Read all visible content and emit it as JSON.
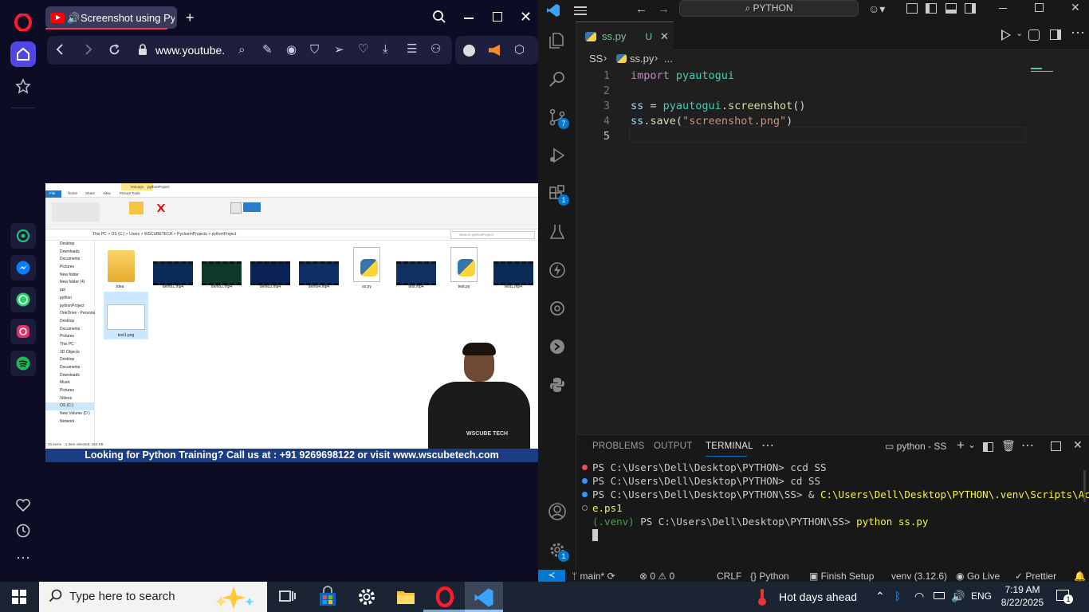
{
  "opera": {
    "tab_title": "Screenshot using Pyth",
    "address": "www.youtube.",
    "video_banner": "Looking for Python Training? Call us at : +91 9269698122 or visit www.wscubetech.com",
    "explorer": {
      "ribbon_tabs": [
        "File",
        "Home",
        "Share",
        "View",
        "Picture Tools"
      ],
      "manage_label": "Manage",
      "window_title": "pythonProject",
      "path": "This PC  >  OS (C:)  >  Users  >  WSCUBETECH  >  PycharmProjects  >  pythonProject",
      "search_placeholder": "Search pythonProject",
      "nav_items": [
        "Desktop",
        "Downloads",
        "Documents",
        "Pictures",
        "New folder",
        "New folder (4)",
        "ppt",
        "python",
        "pythonProject",
        "OneDrive - Persona",
        "Desktop",
        "Documents",
        "Pictures",
        "This PC",
        "3D Objects",
        "Desktop",
        "Documents",
        "Downloads",
        "Music",
        "Pictures",
        "Videos",
        "OS (C:)",
        "New Volume (D:)",
        "Network"
      ],
      "files": [
        ".idea",
        "demo1.mp4",
        "demo2.mp4",
        "demo3.mp4",
        "demo4.mp4",
        "ss.py",
        "test.mp4",
        "test.py",
        "test1.mp4"
      ],
      "selected_file": "test1.png",
      "status": "10 items    1 item selected  164 KB",
      "shirt_text": "WSCUBE TECH"
    }
  },
  "vscode": {
    "search_label": "PYTHON",
    "tab_name": "ss.py",
    "tab_status": "U",
    "breadcrumb": {
      "folder": "SS",
      "file": "ss.py",
      "more": "..."
    },
    "code_lines": [
      {
        "n": "1",
        "tokens": [
          [
            "import",
            "#c586c0"
          ],
          [
            " pyautogui",
            "#4ec9b0"
          ]
        ]
      },
      {
        "n": "2",
        "tokens": []
      },
      {
        "n": "3",
        "tokens": [
          [
            "ss",
            "#9cdcfe"
          ],
          [
            " = ",
            "#d4d4d4"
          ],
          [
            "pyautogui",
            "#4ec9b0"
          ],
          [
            ".",
            "#d4d4d4"
          ],
          [
            "screenshot",
            "#dcdcaa"
          ],
          [
            "()",
            "#d4d4d4"
          ]
        ]
      },
      {
        "n": "4",
        "tokens": [
          [
            "ss",
            "#9cdcfe"
          ],
          [
            ".",
            "#d4d4d4"
          ],
          [
            "save",
            "#dcdcaa"
          ],
          [
            "(",
            "#d4d4d4"
          ],
          [
            "\"screenshot.png\"",
            "#ce9178"
          ],
          [
            ")",
            "#d4d4d4"
          ]
        ]
      },
      {
        "n": "5",
        "tokens": []
      }
    ],
    "panel_tabs": [
      "PROBLEMS",
      "OUTPUT",
      "TERMINAL"
    ],
    "terminal_label": "python - SS",
    "terminal_lines": [
      {
        "dot": "#f14c4c",
        "text": "PS C:\\Users\\Dell\\Desktop\\PYTHON> ccd SS"
      },
      {
        "dot": "#3794ff",
        "text": "PS C:\\Users\\Dell\\Desktop\\PYTHON> cd SS"
      },
      {
        "dot": "#3794ff",
        "text": "PS C:\\Users\\Dell\\Desktop\\PYTHON\\SS> & ",
        "hl": "C:\\Users\\Dell\\Desktop\\PYTHON\\.venv\\Scripts\\Activat"
      },
      {
        "dot": "hollow",
        "hl": "e.ps1"
      },
      {
        "dot": "",
        "venv": "(.venv)",
        "text": " PS C:\\Users\\Dell\\Desktop\\PYTHON\\SS> ",
        "cmd": "python ss.py"
      }
    ],
    "status": {
      "branch": "main*",
      "errors": "0",
      "warnings": "0",
      "eol": "CRLF",
      "language": "Python",
      "finish_setup": "Finish Setup",
      "venv": "venv (3.12.6)",
      "golive": "Go Live",
      "prettier": "Prettier"
    },
    "badges": {
      "scm": "7",
      "extensions": "1",
      "settings": "1"
    }
  },
  "taskbar": {
    "search_placeholder": "Type here to search",
    "weather": "Hot days ahead",
    "lang": "ENG",
    "time": "7:19 AM",
    "date": "8/22/2025",
    "notif": "1"
  }
}
